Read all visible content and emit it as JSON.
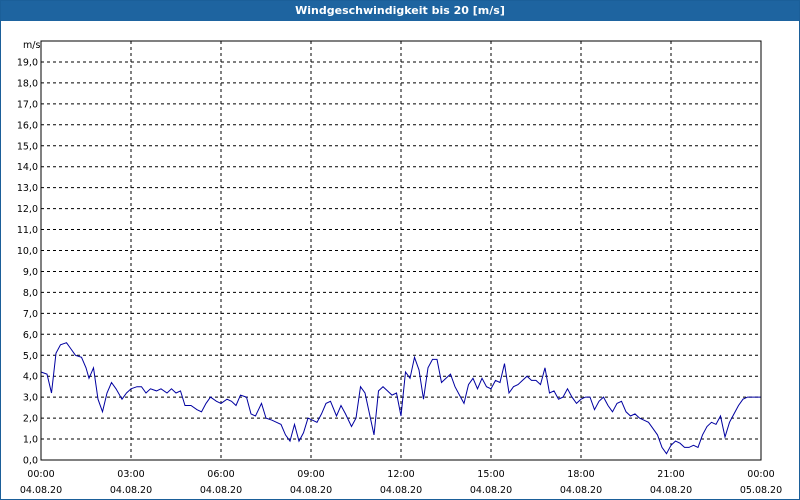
{
  "window": {
    "title": "Windgeschwindigkeit bis 20 [m/s]"
  },
  "colors": {
    "titlebar": "#1e64a0",
    "line": "#0000a0",
    "grid": "#000000"
  },
  "chart_data": {
    "type": "line",
    "title": "Windgeschwindigkeit bis 20 [m/s]",
    "ylabel": "m/s",
    "xlabel": "",
    "ylim": [
      0,
      20
    ],
    "xlim_hours": [
      0,
      24
    ],
    "grid": true,
    "y_ticks": [
      "0,0",
      "1,0",
      "2,0",
      "3,0",
      "4,0",
      "5,0",
      "6,0",
      "7,0",
      "8,0",
      "9,0",
      "10,0",
      "11,0",
      "12,0",
      "13,0",
      "14,0",
      "15,0",
      "16,0",
      "17,0",
      "18,0",
      "19,0"
    ],
    "x_ticks": [
      {
        "time": "00:00",
        "date": "04.08.20"
      },
      {
        "time": "03:00",
        "date": "04.08.20"
      },
      {
        "time": "06:00",
        "date": "04.08.20"
      },
      {
        "time": "09:00",
        "date": "04.08.20"
      },
      {
        "time": "12:00",
        "date": "04.08.20"
      },
      {
        "time": "15:00",
        "date": "04.08.20"
      },
      {
        "time": "18:00",
        "date": "04.08.20"
      },
      {
        "time": "21:00",
        "date": "04.08.20"
      },
      {
        "time": "00:00",
        "date": "05.08.20"
      }
    ],
    "series": [
      {
        "points": [
          [
            0.0,
            4.2
          ],
          [
            0.2,
            4.1
          ],
          [
            0.35,
            3.2
          ],
          [
            0.5,
            5.1
          ],
          [
            0.65,
            5.5
          ],
          [
            0.85,
            5.6
          ],
          [
            1.0,
            5.3
          ],
          [
            1.15,
            5.0
          ],
          [
            1.35,
            4.9
          ],
          [
            1.5,
            4.4
          ],
          [
            1.6,
            3.9
          ],
          [
            1.75,
            4.4
          ],
          [
            1.9,
            2.9
          ],
          [
            2.05,
            2.3
          ],
          [
            2.2,
            3.2
          ],
          [
            2.35,
            3.7
          ],
          [
            2.5,
            3.4
          ],
          [
            2.7,
            2.9
          ],
          [
            2.85,
            3.2
          ],
          [
            3.0,
            3.4
          ],
          [
            3.2,
            3.5
          ],
          [
            3.35,
            3.5
          ],
          [
            3.5,
            3.2
          ],
          [
            3.65,
            3.4
          ],
          [
            3.85,
            3.3
          ],
          [
            4.0,
            3.4
          ],
          [
            4.2,
            3.2
          ],
          [
            4.35,
            3.4
          ],
          [
            4.5,
            3.2
          ],
          [
            4.65,
            3.3
          ],
          [
            4.8,
            2.6
          ],
          [
            5.0,
            2.6
          ],
          [
            5.2,
            2.4
          ],
          [
            5.35,
            2.3
          ],
          [
            5.5,
            2.7
          ],
          [
            5.65,
            3.0
          ],
          [
            5.85,
            2.8
          ],
          [
            6.0,
            2.7
          ],
          [
            6.2,
            2.9
          ],
          [
            6.35,
            2.8
          ],
          [
            6.5,
            2.6
          ],
          [
            6.65,
            3.1
          ],
          [
            6.85,
            3.0
          ],
          [
            7.0,
            2.2
          ],
          [
            7.15,
            2.1
          ],
          [
            7.35,
            2.7
          ],
          [
            7.5,
            2.0
          ],
          [
            7.7,
            1.9
          ],
          [
            7.85,
            1.8
          ],
          [
            8.0,
            1.7
          ],
          [
            8.15,
            1.2
          ],
          [
            8.3,
            0.9
          ],
          [
            8.45,
            1.7
          ],
          [
            8.6,
            0.9
          ],
          [
            8.75,
            1.3
          ],
          [
            8.9,
            2.0
          ],
          [
            9.05,
            1.9
          ],
          [
            9.2,
            1.8
          ],
          [
            9.35,
            2.2
          ],
          [
            9.5,
            2.7
          ],
          [
            9.65,
            2.8
          ],
          [
            9.85,
            2.1
          ],
          [
            10.0,
            2.6
          ],
          [
            10.15,
            2.2
          ],
          [
            10.35,
            1.6
          ],
          [
            10.5,
            2.0
          ],
          [
            10.65,
            3.5
          ],
          [
            10.8,
            3.2
          ],
          [
            10.95,
            2.2
          ],
          [
            11.1,
            1.2
          ],
          [
            11.25,
            3.3
          ],
          [
            11.4,
            3.5
          ],
          [
            11.55,
            3.3
          ],
          [
            11.7,
            3.1
          ],
          [
            11.85,
            3.2
          ],
          [
            12.0,
            2.1
          ],
          [
            12.15,
            4.2
          ],
          [
            12.3,
            3.9
          ],
          [
            12.45,
            4.9
          ],
          [
            12.6,
            4.3
          ],
          [
            12.75,
            2.9
          ],
          [
            12.9,
            4.4
          ],
          [
            13.05,
            4.8
          ],
          [
            13.2,
            4.8
          ],
          [
            13.35,
            3.7
          ],
          [
            13.5,
            3.9
          ],
          [
            13.65,
            4.1
          ],
          [
            13.8,
            3.5
          ],
          [
            13.95,
            3.1
          ],
          [
            14.1,
            2.7
          ],
          [
            14.25,
            3.6
          ],
          [
            14.4,
            3.9
          ],
          [
            14.55,
            3.4
          ],
          [
            14.7,
            3.9
          ],
          [
            14.85,
            3.5
          ],
          [
            15.0,
            3.4
          ],
          [
            15.15,
            3.8
          ],
          [
            15.3,
            3.7
          ],
          [
            15.45,
            4.6
          ],
          [
            15.6,
            3.2
          ],
          [
            15.75,
            3.5
          ],
          [
            15.9,
            3.6
          ],
          [
            16.05,
            3.8
          ],
          [
            16.2,
            4.0
          ],
          [
            16.35,
            3.8
          ],
          [
            16.5,
            3.8
          ],
          [
            16.65,
            3.6
          ],
          [
            16.8,
            4.4
          ],
          [
            16.95,
            3.2
          ],
          [
            17.1,
            3.3
          ],
          [
            17.25,
            2.9
          ],
          [
            17.4,
            3.0
          ],
          [
            17.55,
            3.4
          ],
          [
            17.7,
            3.0
          ],
          [
            17.85,
            2.7
          ],
          [
            18.0,
            2.9
          ],
          [
            18.15,
            3.0
          ],
          [
            18.3,
            3.0
          ],
          [
            18.45,
            2.4
          ],
          [
            18.6,
            2.8
          ],
          [
            18.75,
            3.0
          ],
          [
            18.9,
            2.6
          ],
          [
            19.05,
            2.3
          ],
          [
            19.2,
            2.7
          ],
          [
            19.35,
            2.8
          ],
          [
            19.5,
            2.3
          ],
          [
            19.65,
            2.1
          ],
          [
            19.8,
            2.2
          ],
          [
            19.95,
            2.0
          ],
          [
            20.1,
            1.9
          ],
          [
            20.25,
            1.8
          ],
          [
            20.4,
            1.5
          ],
          [
            20.55,
            1.2
          ],
          [
            20.7,
            0.6
          ],
          [
            20.85,
            0.3
          ],
          [
            21.0,
            0.7
          ],
          [
            21.15,
            0.9
          ],
          [
            21.3,
            0.8
          ],
          [
            21.45,
            0.6
          ],
          [
            21.6,
            0.6
          ],
          [
            21.75,
            0.7
          ],
          [
            21.9,
            0.6
          ],
          [
            22.05,
            1.2
          ],
          [
            22.2,
            1.6
          ],
          [
            22.35,
            1.8
          ],
          [
            22.5,
            1.7
          ],
          [
            22.65,
            2.1
          ],
          [
            22.8,
            1.1
          ],
          [
            22.95,
            1.8
          ],
          [
            23.1,
            2.2
          ],
          [
            23.25,
            2.6
          ],
          [
            23.4,
            2.9
          ],
          [
            23.55,
            3.0
          ],
          [
            23.7,
            3.0
          ],
          [
            23.85,
            3.0
          ],
          [
            24.0,
            3.0
          ]
        ]
      }
    ]
  }
}
